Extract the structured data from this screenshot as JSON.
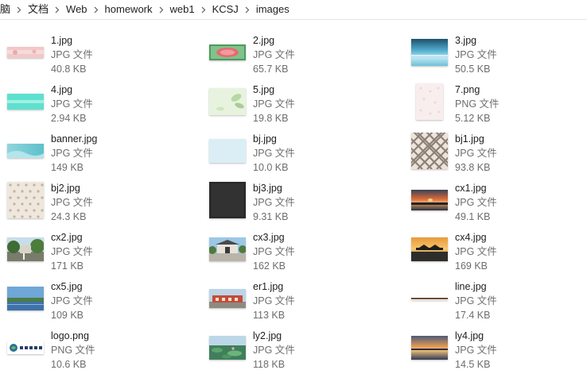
{
  "breadcrumb": [
    "脑",
    "文档",
    "Web",
    "homework",
    "web1",
    "KCSJ",
    "images"
  ],
  "files": [
    {
      "name": "1.jpg",
      "type": "JPG 文件",
      "size": "40.8 KB",
      "thumb": "pink-strip"
    },
    {
      "name": "2.jpg",
      "type": "JPG 文件",
      "size": "65.7 KB",
      "thumb": "watermelon"
    },
    {
      "name": "3.jpg",
      "type": "JPG 文件",
      "size": "50.5 KB",
      "thumb": "sky-sea"
    },
    {
      "name": "4.jpg",
      "type": "JPG 文件",
      "size": "2.94 KB",
      "thumb": "cyan-strip"
    },
    {
      "name": "5.jpg",
      "type": "JPG 文件",
      "size": "19.8 KB",
      "thumb": "green-leaves"
    },
    {
      "name": "7.png",
      "type": "PNG 文件",
      "size": "5.12 KB",
      "thumb": "pale-pattern"
    },
    {
      "name": "banner.jpg",
      "type": "JPG 文件",
      "size": "149 KB",
      "thumb": "teal-banner"
    },
    {
      "name": "bj.jpg",
      "type": "JPG 文件",
      "size": "10.0 KB",
      "thumb": "light-blue"
    },
    {
      "name": "bj1.jpg",
      "type": "JPG 文件",
      "size": "93.8 KB",
      "thumb": "diamond-lattice"
    },
    {
      "name": "bj2.jpg",
      "type": "JPG 文件",
      "size": "24.3 KB",
      "thumb": "beige-dots"
    },
    {
      "name": "bj3.jpg",
      "type": "JPG 文件",
      "size": "9.31 KB",
      "thumb": "dark-gray"
    },
    {
      "name": "cx1.jpg",
      "type": "JPG 文件",
      "size": "49.1 KB",
      "thumb": "sunset-lake"
    },
    {
      "name": "cx2.jpg",
      "type": "JPG 文件",
      "size": "171 KB",
      "thumb": "park-trees"
    },
    {
      "name": "cx3.jpg",
      "type": "JPG 文件",
      "size": "162 KB",
      "thumb": "campus-gate"
    },
    {
      "name": "cx4.jpg",
      "type": "JPG 文件",
      "size": "169 KB",
      "thumb": "pavilion-dusk"
    },
    {
      "name": "cx5.jpg",
      "type": "JPG 文件",
      "size": "109 KB",
      "thumb": "blue-lake"
    },
    {
      "name": "er1.jpg",
      "type": "JPG 文件",
      "size": "113 KB",
      "thumb": "red-building"
    },
    {
      "name": "line.jpg",
      "type": "JPG 文件",
      "size": "17.4 KB",
      "thumb": "thin-line"
    },
    {
      "name": "logo.png",
      "type": "PNG 文件",
      "size": "10.6 KB",
      "thumb": "logo-mark"
    },
    {
      "name": "ly2.jpg",
      "type": "JPG 文件",
      "size": "118 KB",
      "thumb": "lotus-pond"
    },
    {
      "name": "ly4.jpg",
      "type": "JPG 文件",
      "size": "14.5 KB",
      "thumb": "dusk-water"
    }
  ]
}
